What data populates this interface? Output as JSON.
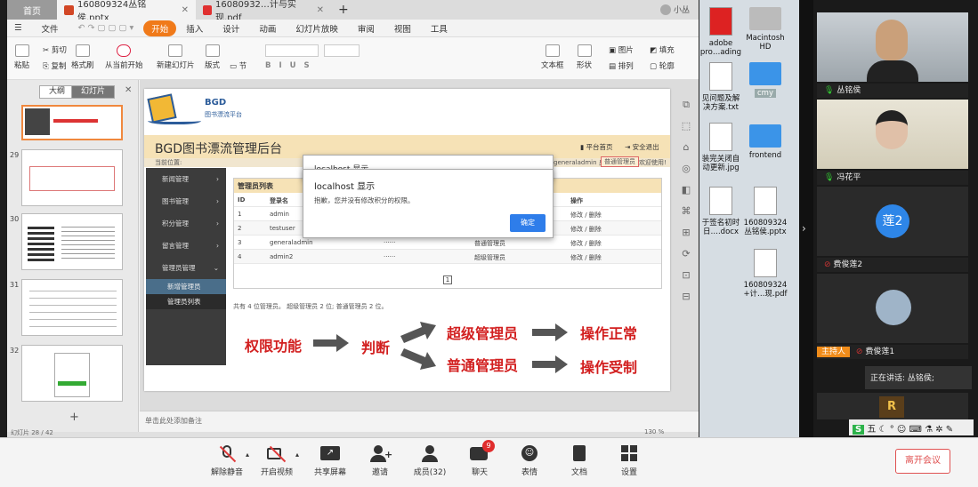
{
  "wps": {
    "tabs": [
      {
        "label": "首页"
      },
      {
        "label": "160809324丛铭侯.pptx"
      },
      {
        "label": "16080932…计与实现.pdf"
      }
    ],
    "user_badge": "小丛",
    "menu": [
      "文件",
      "开始",
      "插入",
      "设计",
      "动画",
      "幻灯片放映",
      "审阅",
      "视图",
      "工具"
    ],
    "ribbon": {
      "paste": "粘贴",
      "cut": "剪切",
      "copy": "复制",
      "format_painter": "格式刷",
      "from_current": "从当前开始",
      "new_slide": "新建幻灯片",
      "layout": "版式",
      "section": "节",
      "textbox": "文本框",
      "shape": "形状",
      "picture": "图片",
      "arrange": "排列",
      "outline": "轮廓",
      "fill": "填充"
    },
    "pane_tabs": [
      "大纲",
      "幻灯片"
    ],
    "thumb_numbers": [
      "29",
      "30",
      "31",
      "32"
    ],
    "add_slide": "+",
    "notes": "单击此处添加备注",
    "status": {
      "slide": "幻灯片 28 / 42",
      "zoom": "130 %"
    }
  },
  "slide": {
    "logo_text": "BGD",
    "logo_sub": "图书漂流平台",
    "admin_title": "BGD图书漂流管理后台",
    "platform_home": "平台首页",
    "logout": "安全退出",
    "current_location": "当前位置:",
    "user_info": "generaladmin 身份",
    "role": "普通管理员",
    "welcome": "欢迎使用!",
    "side_menu": [
      "新闻管理",
      "图书管理",
      "积分管理",
      "留言管理",
      "管理员管理"
    ],
    "side_sub": [
      "新增管理员",
      "管理员列表"
    ],
    "table_title": "管理员列表",
    "columns": [
      "ID",
      "登录名",
      "操作"
    ],
    "rows": [
      {
        "id": "1",
        "login": "admin",
        "pwd": "",
        "role": "",
        "op": "修改 / 删除"
      },
      {
        "id": "2",
        "login": "testuser",
        "pwd": "",
        "role": "",
        "op": "修改 / 删除"
      },
      {
        "id": "3",
        "login": "generaladmin",
        "pwd": "······",
        "role": "普通管理员",
        "op": "修改 / 删除"
      },
      {
        "id": "4",
        "login": "admin2",
        "pwd": "······",
        "role": "超级管理员",
        "op": "修改 / 删除"
      }
    ],
    "page_num": "1",
    "summary": "共有 4 位管理员。 超级管理员 2 位; 普通管理员 2 位。",
    "diagram": {
      "left": "权限功能",
      "mid": "判断",
      "top_role": "超级管理员",
      "bottom_role": "普通管理员",
      "top_result": "操作正常",
      "bottom_result": "操作受制"
    }
  },
  "dialog_back": {
    "title": "localhost 显示"
  },
  "dialog": {
    "title": "localhost 显示",
    "message": "抱歉，您并没有修改积分的权限。",
    "ok": "确定"
  },
  "desktop": {
    "icons": [
      "adobe\npro…ading",
      "Macintosh\nHD",
      "见问题及解\n决方案.txt",
      "cmy",
      "装完关闭自\n动更新.jpg",
      "frontend",
      "于签名初时\n日….docx",
      "160809324\n丛铭侯.pptx",
      "160809324\n+计…现.pdf"
    ]
  },
  "participants": {
    "p1": "丛铭侯",
    "p2": "冯花平",
    "p3_avatar": "莲2",
    "p3": "费俊莲2",
    "host_badge": "主持人",
    "p4": "费俊莲1",
    "speaking": "正在讲话: 丛铭侯;",
    "p5_initial": "R",
    "ime": "五"
  },
  "toolbar": {
    "unmute": "解除静音",
    "video": "开启视频",
    "share": "共享屏幕",
    "invite": "邀请",
    "members": "成员(32)",
    "chat": "聊天",
    "chat_badge": "9",
    "emoji": "表情",
    "docs": "文档",
    "settings": "设置",
    "leave": "离开会议"
  }
}
